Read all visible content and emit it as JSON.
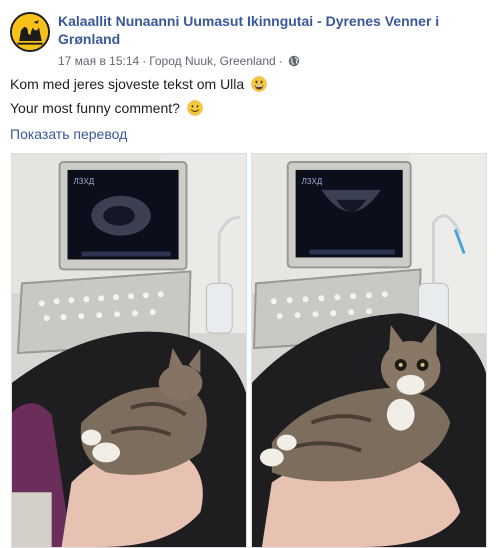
{
  "post": {
    "page_name": "Kalaallit Nunaanni Uumasut Ikinngutai - Dyrenes Venner i Grønland",
    "date": "17 мая в 15:14",
    "location": "Город Nuuk, Greenland",
    "separator": "·",
    "privacy_icon": "globe-icon",
    "text_lines": [
      "Kom med jeres sjoveste tekst om Ulla",
      "Your most funny comment?"
    ],
    "emojis": [
      "grinning-face-emoji",
      "slightly-smiling-face-emoji"
    ],
    "translate_label": "Показать перевод",
    "photos": [
      {
        "name": "photo-cat-on-ultrasound-1",
        "screen_text": "ЛЗХД"
      },
      {
        "name": "photo-cat-on-ultrasound-2",
        "screen_text": "ЛЗХД"
      }
    ]
  },
  "colors": {
    "link": "#385898",
    "meta": "#606770",
    "text": "#1c1e21",
    "avatar_bg": "#f6c21a"
  }
}
